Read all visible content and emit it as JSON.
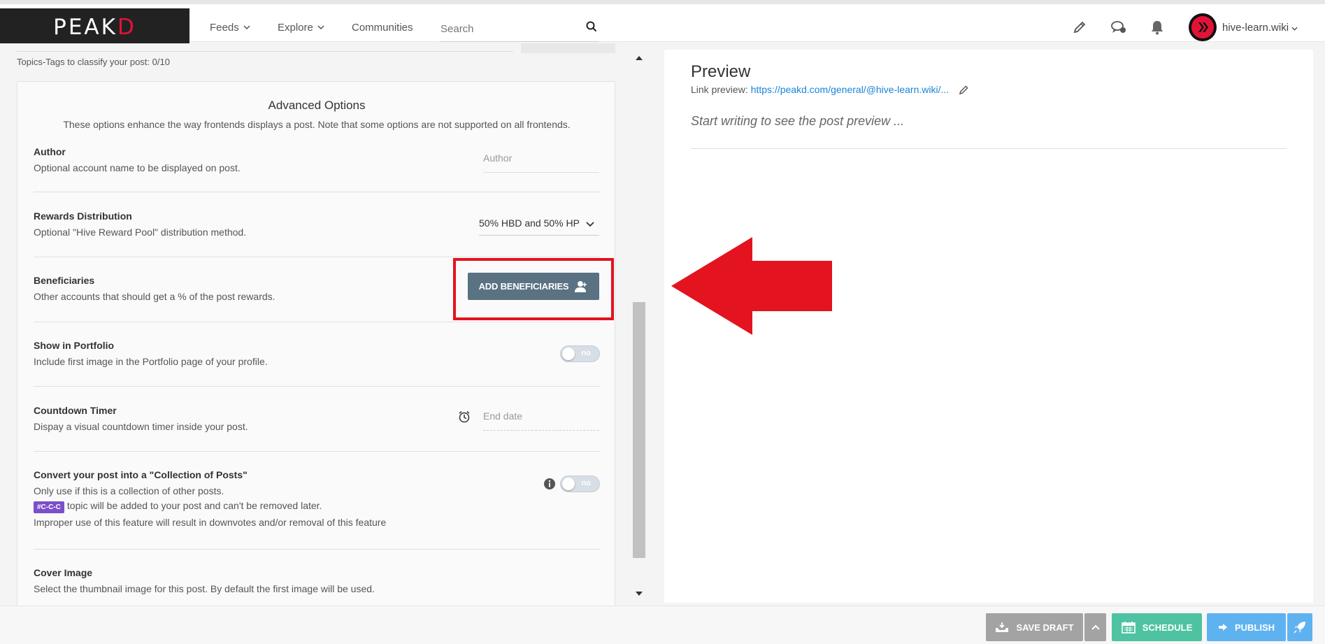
{
  "header": {
    "logo_text_prefix": "PE",
    "logo_text_a": "A",
    "logo_text_k": "K",
    "logo_text_d": "D",
    "nav": {
      "feeds": "Feeds",
      "explore": "Explore",
      "communities": "Communities"
    },
    "search_placeholder": "Search",
    "username": "hive-learn.wiki"
  },
  "editor": {
    "tags_count": "Topics-Tags to classify your post: 0/10",
    "advanced": {
      "title": "Advanced Options",
      "description": "These options enhance the way frontends displays a post. Note that some options are not supported on all frontends.",
      "author": {
        "label": "Author",
        "desc": "Optional account name to be displayed on post.",
        "placeholder": "Author"
      },
      "rewards": {
        "label": "Rewards Distribution",
        "desc": "Optional \"Hive Reward Pool\" distribution method.",
        "selected": "50% HBD and 50% HP"
      },
      "beneficiaries": {
        "label": "Beneficiaries",
        "desc": "Other accounts that should get a % of the post rewards.",
        "button": "ADD BENEFICIARIES"
      },
      "portfolio": {
        "label": "Show in Portfolio",
        "desc": "Include first image in the Portfolio page of your profile.",
        "toggle": "no"
      },
      "countdown": {
        "label": "Countdown Timer",
        "desc": "Dispay a visual countdown timer inside your post.",
        "placeholder": "End date"
      },
      "collection": {
        "label": "Convert your post into a \"Collection of Posts\"",
        "desc1": "Only use if this is a collection of other posts.",
        "badge": "#C-C-C",
        "desc2": "topic will be added to your post and can't be removed later.",
        "desc3": "Improper use of this feature will result in downvotes and/or removal of this feature",
        "toggle": "no"
      },
      "cover": {
        "label": "Cover Image",
        "desc": "Select the thumbnail image for this post. By default the first image will be used."
      }
    }
  },
  "preview": {
    "title": "Preview",
    "link_label": "Link preview:",
    "link_url": "https://peakd.com/general/@hive-learn.wiki/...",
    "placeholder": "Start writing to see the post preview ..."
  },
  "footer": {
    "save_draft": "SAVE DRAFT",
    "schedule": "SCHEDULE",
    "publish": "PUBLISH"
  },
  "colors": {
    "brand_red": "#e31337",
    "beneficiaries_button": "#5a7282",
    "annotation_red": "#e31320",
    "schedule": "#4fc3a1",
    "publish": "#5fb2f0",
    "save_draft": "#a0a0a0",
    "badge": "#7b4fc9"
  }
}
